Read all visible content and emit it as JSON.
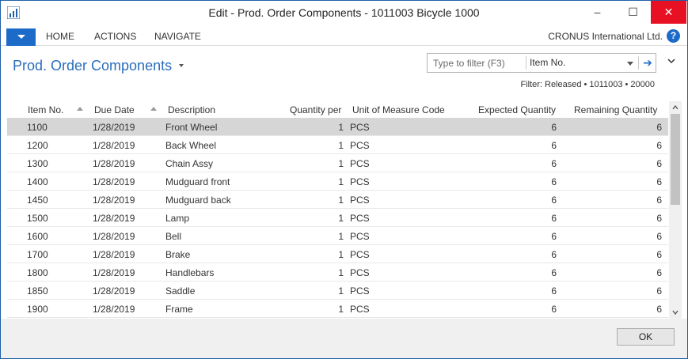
{
  "window": {
    "title": "Edit - Prod. Order Components - 1011003 Bicycle 1000",
    "app_icon": "nav-logo-icon",
    "controls": {
      "minimize": "–",
      "maximize": "☐",
      "close": "✕"
    }
  },
  "ribbon": {
    "app_button_icon": "chevron-down-icon",
    "tabs": [
      "HOME",
      "ACTIONS",
      "NAVIGATE"
    ],
    "company": "CRONUS International Ltd.",
    "help_icon": "?"
  },
  "page": {
    "title": "Prod. Order Components",
    "filter_placeholder": "Type to filter (F3)",
    "filter_field": "Item No.",
    "filter_go": "➔",
    "filter_text": "Filter: Released • 1011003 • 20000"
  },
  "table": {
    "headers": {
      "item_no": "Item No.",
      "due_date": "Due Date",
      "description": "Description",
      "quantity_per": "Quantity per",
      "uom": "Unit of Measure Code",
      "expected_qty": "Expected Quantity",
      "remaining_qty": "Remaining Quantity"
    },
    "rows": [
      {
        "item_no": "1100",
        "due_date": "1/28/2019",
        "description": "Front Wheel",
        "quantity_per": "1",
        "uom": "PCS",
        "expected_qty": "6",
        "remaining_qty": "6"
      },
      {
        "item_no": "1200",
        "due_date": "1/28/2019",
        "description": "Back Wheel",
        "quantity_per": "1",
        "uom": "PCS",
        "expected_qty": "6",
        "remaining_qty": "6"
      },
      {
        "item_no": "1300",
        "due_date": "1/28/2019",
        "description": "Chain Assy",
        "quantity_per": "1",
        "uom": "PCS",
        "expected_qty": "6",
        "remaining_qty": "6"
      },
      {
        "item_no": "1400",
        "due_date": "1/28/2019",
        "description": "Mudguard front",
        "quantity_per": "1",
        "uom": "PCS",
        "expected_qty": "6",
        "remaining_qty": "6"
      },
      {
        "item_no": "1450",
        "due_date": "1/28/2019",
        "description": "Mudguard back",
        "quantity_per": "1",
        "uom": "PCS",
        "expected_qty": "6",
        "remaining_qty": "6"
      },
      {
        "item_no": "1500",
        "due_date": "1/28/2019",
        "description": "Lamp",
        "quantity_per": "1",
        "uom": "PCS",
        "expected_qty": "6",
        "remaining_qty": "6"
      },
      {
        "item_no": "1600",
        "due_date": "1/28/2019",
        "description": "Bell",
        "quantity_per": "1",
        "uom": "PCS",
        "expected_qty": "6",
        "remaining_qty": "6"
      },
      {
        "item_no": "1700",
        "due_date": "1/28/2019",
        "description": "Brake",
        "quantity_per": "1",
        "uom": "PCS",
        "expected_qty": "6",
        "remaining_qty": "6"
      },
      {
        "item_no": "1800",
        "due_date": "1/28/2019",
        "description": "Handlebars",
        "quantity_per": "1",
        "uom": "PCS",
        "expected_qty": "6",
        "remaining_qty": "6"
      },
      {
        "item_no": "1850",
        "due_date": "1/28/2019",
        "description": "Saddle",
        "quantity_per": "1",
        "uom": "PCS",
        "expected_qty": "6",
        "remaining_qty": "6"
      },
      {
        "item_no": "1900",
        "due_date": "1/28/2019",
        "description": "Frame",
        "quantity_per": "1",
        "uom": "PCS",
        "expected_qty": "6",
        "remaining_qty": "6"
      }
    ]
  },
  "footer": {
    "ok_label": "OK"
  },
  "colors": {
    "accent": "#1d6bc8",
    "title_blue": "#2a6ebb",
    "selected_row": "#d6d6d6",
    "close_red": "#e81123"
  }
}
